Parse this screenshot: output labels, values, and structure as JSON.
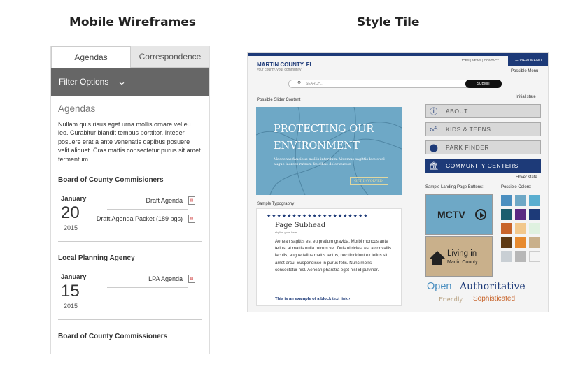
{
  "headings": {
    "mobile": "Mobile Wireframes",
    "style": "Style Tile"
  },
  "mobile": {
    "tabs": [
      {
        "label": "Agendas"
      },
      {
        "label": "Correspondence"
      }
    ],
    "filter_label": "Filter Options",
    "section_title": "Agendas",
    "intro": "Nullam quis risus eget urna mollis ornare vel eu leo. Curabitur blandit tempus porttitor. Integer posuere erat a ante venenatis dapibus posuere velit aliquet. Cras mattis consectetur purus sit amet fermentum.",
    "groups": [
      {
        "title": "Board of County Commisioners",
        "month": "January",
        "day": "20",
        "year": "2015",
        "docs": [
          "Draft Agenda",
          "Draft Agenda Packet (189 pgs)"
        ]
      },
      {
        "title": "Local Planning Agency",
        "month": "January",
        "day": "15",
        "year": "2015",
        "docs": [
          "LPA Agenda"
        ]
      },
      {
        "title": "Board of County Commissioners"
      }
    ]
  },
  "tile": {
    "brand": "MARTIN COUNTY, FL",
    "brand_sub": "your county, your community",
    "top_links": "JOBS | NEWS | CONTACT",
    "view_menu": "VIEW MENU",
    "possible_menu": "Possible Menu",
    "search_placeholder": "SEARCH...",
    "submit": "SUBMIT",
    "slider_label": "Possible Slider Content",
    "slider_heading": "PROTECTING OUR ENVIRONMENT",
    "slider_text": "Maecenas faucibus mollis interdum. Vivamus sagittis lacus vel augue laoreet rutrum faucibus dolor auctor.",
    "slider_button": "GET INVOLVED!",
    "initial_state": "Initial state",
    "hover_state": "Hover state",
    "nav": [
      {
        "label": "ABOUT",
        "icon": "info-icon"
      },
      {
        "label": "KIDS & TEENS",
        "icon": "thumbs-up-icon"
      },
      {
        "label": "PARK FINDER",
        "icon": "map-pin-icon"
      },
      {
        "label": "COMMUNITY CENTERS",
        "icon": "building-icon"
      }
    ],
    "typography_label": "Sample Typography",
    "typo_subhead": "Page Subhead",
    "typo_sub": "skyline goes here",
    "typo_body": "Aenean sagittis est eu pretium gravida. Morbi rhoncus ante tellus, at mattis nulla rutrum vel. Duis ultricies, est a convallis iaculis, augue tellus mattis lectus, nec tincidunt ex tellus sit amet arcu. Suspendisse in purus felis. Nunc mollis consectetur nisl. Aenean pharetra eget nisl id pulvinar.",
    "typo_link": "This is an example of a block text link  ›",
    "landing_label": "Sample Landing Page Buttons:",
    "colors_label": "Possible Colors:",
    "mctv": "MCTV",
    "living_in": "Living in",
    "martin_county": "Martin County",
    "colors": [
      "#4b8fc0",
      "#6ea8c6",
      "#5aaed0",
      "#1b5e6e",
      "#5b2a82",
      "#1d3a78",
      "#c8642b",
      "#f2c88d",
      "#dff1e0",
      "#5e3a15",
      "#e78a2f",
      "#c9b08b",
      "#c9cfd4",
      "#b7b7b7",
      "#f4f4f4"
    ],
    "words": {
      "open": "Open",
      "authoritative": "Authoritative",
      "friendly": "Friendly",
      "sophisticated": "Sophisticated"
    }
  }
}
